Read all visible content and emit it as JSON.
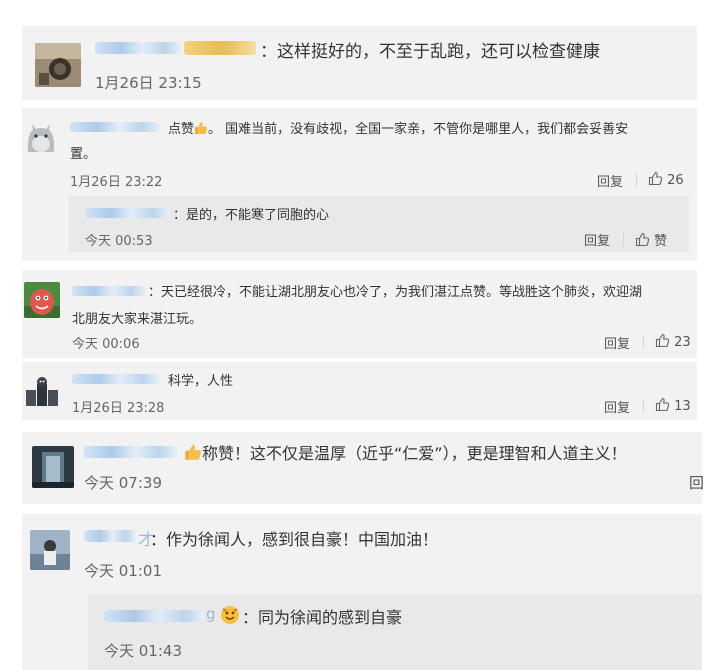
{
  "comments": [
    {
      "text": "：这样挺好的，不至于乱跑，还可以检查健康",
      "time": "1月26日 23:15"
    },
    {
      "text_line1_pre": "点赞",
      "text_line1_post": "。 国难当前，没有歧视，全国一家亲，不管你是哪里人，我们都会妥善安",
      "text_line2": "置。",
      "time": "1月26日 23:22",
      "reply_label": "回复",
      "like_count": "26",
      "reply": {
        "text": "：是的，不能寒了同胞的心",
        "time": "今天 00:53",
        "reply_label": "回复",
        "like_label": "赞"
      }
    },
    {
      "text_line1": "：天已经很冷，不能让湖北朋友心也冷了，为我们湛江点赞。等战胜这个肺炎，欢迎湖",
      "text_line2": "北朋友大家来湛江玩。",
      "time": "今天 00:06",
      "reply_label": "回复",
      "like_count": "23"
    },
    {
      "text": "科学，人性",
      "time": "1月26日 23:28",
      "reply_label": "回复",
      "like_count": "13"
    },
    {
      "text": "称赞！这不仅是温厚（近乎“仁爱”），更是理智和人道主义！",
      "time": "今天 07:39",
      "reply_label_cut": "回"
    },
    {
      "name_visible": "才",
      "text": "：作为徐闻人，感到很自豪！中国加油！",
      "time": "今天 01:01",
      "reply": {
        "name_visible": "g",
        "text": "：同为徐闻的感到自豪",
        "time": "今天 01:43"
      }
    }
  ],
  "icons": {
    "thumbs_up": "thumbs-up-icon",
    "like": "like-outline-icon"
  },
  "colors": {
    "card_bg": "#f2f2f2",
    "reply_bg": "#e9e9e9",
    "blurred_name": "#a9c8e8"
  }
}
